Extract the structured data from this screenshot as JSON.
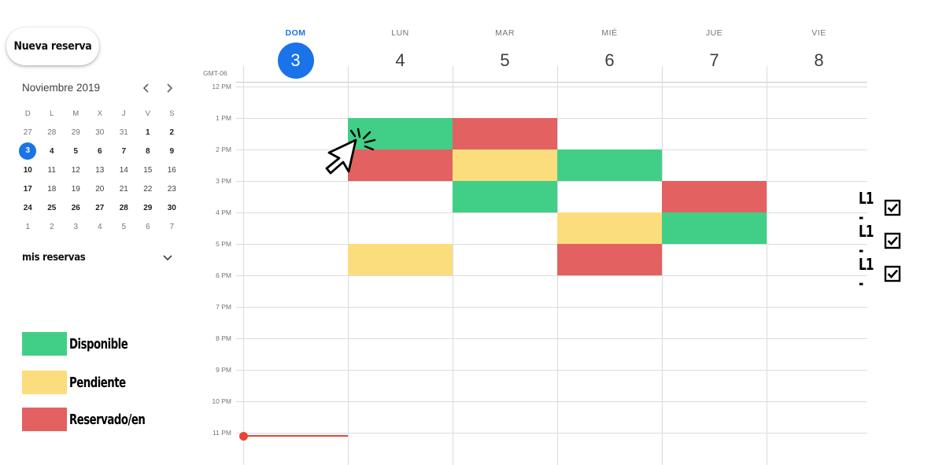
{
  "new_reservation_label": "Nueva reserva",
  "mini_calendar": {
    "month_title": "Noviembre 2019",
    "prev_icon": "chevron-left-icon",
    "next_icon": "chevron-right-icon",
    "weekdays": [
      "D",
      "L",
      "M",
      "X",
      "J",
      "V",
      "S"
    ],
    "weeks": [
      [
        "27",
        "28",
        "29",
        "30",
        "31",
        "1",
        "2"
      ],
      [
        "3",
        "4",
        "5",
        "6",
        "7",
        "8",
        "9"
      ],
      [
        "10",
        "11",
        "12",
        "13",
        "14",
        "15",
        "16"
      ],
      [
        "17",
        "18",
        "19",
        "20",
        "21",
        "22",
        "23"
      ],
      [
        "24",
        "25",
        "26",
        "27",
        "28",
        "29",
        "30"
      ],
      [
        "1",
        "2",
        "3",
        "4",
        "5",
        "6",
        "7"
      ]
    ],
    "today": "3"
  },
  "my_reservations_label": "mis reservas",
  "legend": [
    {
      "label": "Disponible",
      "color": "#41cf87"
    },
    {
      "label": "Pendiente",
      "color": "#fbdd7d"
    },
    {
      "label": "Reservado/en",
      "color": "#e36161"
    }
  ],
  "timezone": "GMT-06",
  "days": [
    {
      "dow": "DOM",
      "num": "3",
      "active": true
    },
    {
      "dow": "LUN",
      "num": "4",
      "active": false
    },
    {
      "dow": "MAR",
      "num": "5",
      "active": false
    },
    {
      "dow": "MIÉ",
      "num": "6",
      "active": false
    },
    {
      "dow": "JUE",
      "num": "7",
      "active": false
    },
    {
      "dow": "VIE",
      "num": "8",
      "active": false
    }
  ],
  "hours": [
    "12 PM",
    "1 PM",
    "2 PM",
    "3 PM",
    "4 PM",
    "5 PM",
    "6 PM",
    "7 PM",
    "8 PM",
    "9 PM",
    "10 PM",
    "11 PM"
  ],
  "slots": [
    {
      "day": 1,
      "start": 1,
      "end": 2,
      "status": "disponible"
    },
    {
      "day": 1,
      "start": 2,
      "end": 3,
      "status": "reservado"
    },
    {
      "day": 1,
      "start": 5,
      "end": 6,
      "status": "pendiente"
    },
    {
      "day": 2,
      "start": 1,
      "end": 2,
      "status": "reservado"
    },
    {
      "day": 2,
      "start": 2,
      "end": 3,
      "status": "pendiente"
    },
    {
      "day": 2,
      "start": 3,
      "end": 4,
      "status": "disponible"
    },
    {
      "day": 3,
      "start": 2,
      "end": 3,
      "status": "disponible"
    },
    {
      "day": 3,
      "start": 4,
      "end": 5,
      "status": "pendiente"
    },
    {
      "day": 3,
      "start": 5,
      "end": 6,
      "status": "reservado"
    },
    {
      "day": 4,
      "start": 3,
      "end": 4,
      "status": "reservado"
    },
    {
      "day": 4,
      "start": 4,
      "end": 5,
      "status": "disponible"
    }
  ],
  "l1_markers": [
    {
      "label": "L1 -",
      "icon": "checkbox-checked-icon"
    },
    {
      "label": "L1 -",
      "icon": "checkbox-checked-icon"
    },
    {
      "label": "L1 -",
      "icon": "checkbox-checked-icon"
    }
  ],
  "cursor_icon": "click-cursor-icon",
  "current_time_indicator": "current-time-line"
}
